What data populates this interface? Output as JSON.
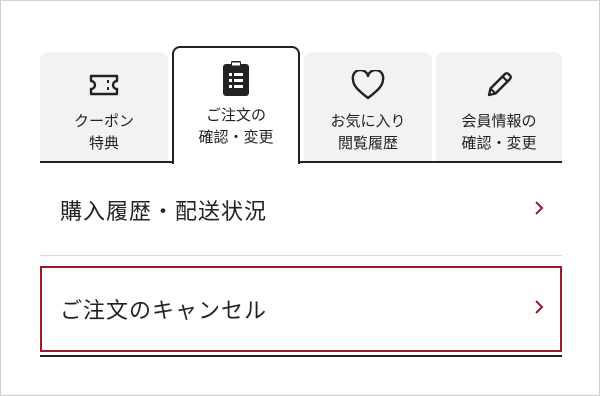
{
  "tabs": [
    {
      "label": "クーポン\n特典",
      "icon": "ticket-icon"
    },
    {
      "label": "ご注文の\n確認・変更",
      "icon": "clipboard-list-icon",
      "active": true
    },
    {
      "label": "お気に入り\n閲覧履歴",
      "icon": "heart-icon"
    },
    {
      "label": "会員情報の\n確認・変更",
      "icon": "pencil-icon"
    }
  ],
  "menu": {
    "purchase_history": "購入履歴・配送状況",
    "cancel_order": "ご注文のキャンセル"
  },
  "colors": {
    "accent": "#9b1a2a",
    "text": "#222222",
    "tab_bg": "#f2f2f2"
  }
}
